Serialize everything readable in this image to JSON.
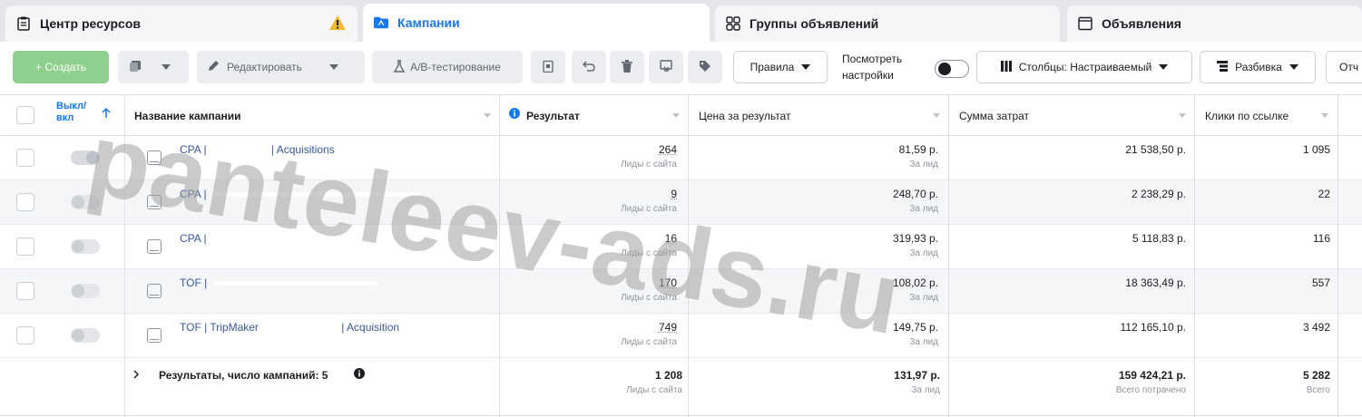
{
  "tabs": [
    {
      "label": "Центр ресурсов",
      "icon": "resource-center-icon"
    },
    {
      "label": "Кампании",
      "icon": "campaigns-icon"
    },
    {
      "label": "Группы объявлений",
      "icon": "adsets-icon"
    },
    {
      "label": "Объявления",
      "icon": "ads-icon"
    }
  ],
  "toolbar": {
    "create": "+ Создать",
    "edit": "Редактировать",
    "ab_test": "A/B-тестирование",
    "rules": "Правила",
    "view_settings_line1": "Посмотреть",
    "view_settings_line2": "настройки",
    "columns": "Столбцы: Настраиваемый",
    "breakdown": "Разбивка",
    "reports": "Отч"
  },
  "columns": {
    "onoff_line1": "Выкл/",
    "onoff_line2": "вкл",
    "name": "Название кампании",
    "result": "Результат",
    "cost_per_result": "Цена за результат",
    "amount_spent": "Сумма затрат",
    "link_clicks": "Клики по ссылке"
  },
  "rows": [
    {
      "name": "CPA | ",
      "name_tail": "| Acquisitions",
      "result": "264",
      "result_sub": "Лиды с сайта",
      "cpr": "81,59 р.",
      "cpr_sub": "За лид",
      "spent": "21 538,50 р.",
      "clicks": "1 095",
      "on": true
    },
    {
      "name": "CPA | ",
      "name_tail": "",
      "result": "9",
      "result_sub": "Лиды с сайта",
      "cpr": "248,70 р.",
      "cpr_sub": "За лид",
      "spent": "2 238,29 р.",
      "clicks": "22",
      "on": false
    },
    {
      "name": "CPA | ",
      "name_tail": "",
      "result": "16",
      "result_sub": "Лиды с сайта",
      "cpr": "319,93 р.",
      "cpr_sub": "За лид",
      "spent": "5 118,83 р.",
      "clicks": "116",
      "on": false
    },
    {
      "name": "TOF | ",
      "name_tail": "",
      "result": "170",
      "result_sub": "Лиды с сайта",
      "cpr": "108,02 р.",
      "cpr_sub": "За лид",
      "spent": "18 363,49 р.",
      "clicks": "557",
      "on": false
    },
    {
      "name": "TOF | TripMaker ",
      "name_tail": "| Acquisition",
      "result": "749",
      "result_sub": "Лиды с сайта",
      "cpr": "149,75 р.",
      "cpr_sub": "За лид",
      "spent": "112 165,10 р.",
      "clicks": "3 492",
      "on": false
    }
  ],
  "totals": {
    "label": "Результаты, число кампаний: 5",
    "result": "1 208",
    "result_sub": "Лиды с сайта",
    "cpr": "131,97 р.",
    "cpr_sub": "За лид",
    "spent": "159 424,21 р.",
    "spent_sub": "Всего потрачено",
    "clicks": "5 282",
    "clicks_sub": "Всего"
  },
  "watermark": "panteleev-ads.ru",
  "colors": {
    "accent": "#1877f2",
    "link": "#385898",
    "create": "#8fd08f",
    "warning": "#f7b928"
  }
}
